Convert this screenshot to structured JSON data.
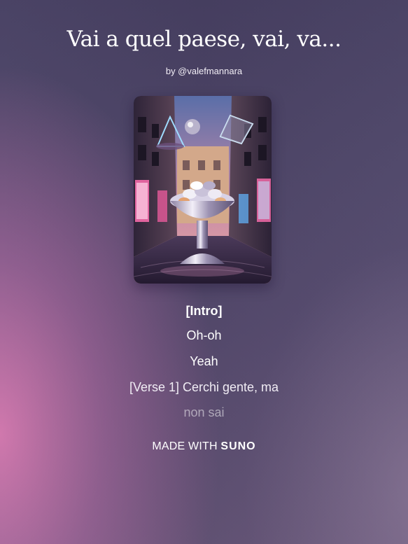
{
  "song": {
    "title": "Vai a quel paese, vai, va...",
    "byline": "by @valefmannara"
  },
  "cover_art": {
    "icon": "cover-art-image"
  },
  "lyrics": {
    "lines": [
      "[Intro]",
      "Oh-oh",
      "Yeah",
      "[Verse 1] Cerchi gente, ma",
      "non sai"
    ]
  },
  "footer": {
    "made_with": "MADE WITH",
    "brand": "SUNO"
  },
  "colors": {
    "background_top": "#4a4365",
    "background_pink_glow": "#d67ab0",
    "text": "#ffffff"
  }
}
